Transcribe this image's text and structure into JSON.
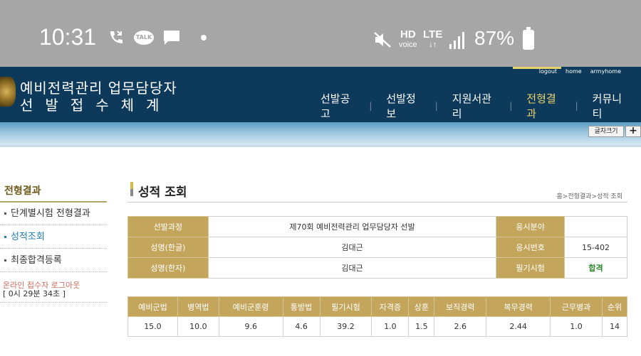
{
  "status_bar": {
    "time": "10:31",
    "battery": "87%",
    "hd": "HD",
    "hd_sub": "voice",
    "lte": "LTE",
    "lte_sub": "↓↑",
    "talk": "TALK"
  },
  "header": {
    "title_line1": "예비전력관리 업무담당자",
    "title_line2": "선발접수체계",
    "top_links": [
      "logout",
      "home",
      "armyhome"
    ],
    "nav": [
      {
        "label": "선발공고",
        "active": false
      },
      {
        "label": "선발정보",
        "active": false
      },
      {
        "label": "지원서관리",
        "active": false
      },
      {
        "label": "전형결과",
        "active": true
      },
      {
        "label": "커뮤니티",
        "active": false
      }
    ],
    "font_size_button": "글자크기",
    "plus_button": "+"
  },
  "sidebar": {
    "title": "전형결과",
    "items": [
      {
        "label": "단계별시험 전형결과",
        "active": false
      },
      {
        "label": "성적조회",
        "active": true
      },
      {
        "label": "최종합격등록",
        "active": false
      }
    ],
    "logout_text": "온라인 접수자 로그아웃",
    "logout_timer": "[ 0시 29분 34초 ]"
  },
  "content": {
    "title": "성적 조회",
    "breadcrumb": "홈>전형결과>성적 조회",
    "info_table": {
      "rows": [
        {
          "h1": "선발과정",
          "v1": "제70회 예비전력관리 업무담당자 선발",
          "h2": "응시분야",
          "v2": ""
        },
        {
          "h1": "성명(한글)",
          "v1": "김대근",
          "h2": "응시번호",
          "v2": "15-402"
        },
        {
          "h1": "성명(한자)",
          "v1": "김대근",
          "h2": "필기시험",
          "v2": "합격"
        }
      ]
    },
    "score_table": {
      "headers": [
        "예비군법",
        "병역법",
        "예비군훈령",
        "통방법",
        "필기시험",
        "자격증",
        "상훈",
        "보직경력",
        "복무경력",
        "근무병과",
        "순위"
      ],
      "values": [
        "15.0",
        "10.0",
        "9.6",
        "4.6",
        "39.2",
        "1.0",
        "1.5",
        "2.6",
        "2.44",
        "1.0",
        "14"
      ]
    }
  },
  "colors": {
    "header_bg": "#0d3a5a",
    "accent_gold": "#c3a55c",
    "nav_active": "#e8d26a",
    "pass_green": "#2b8a2b"
  }
}
